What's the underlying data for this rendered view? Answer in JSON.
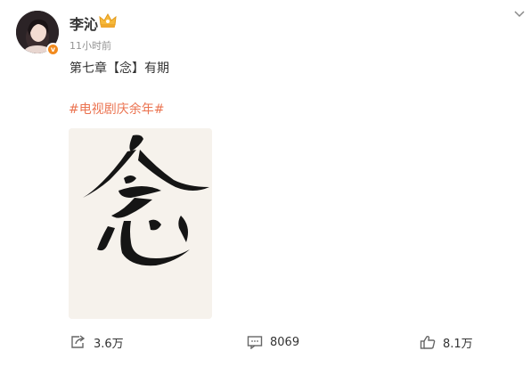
{
  "post": {
    "author": "李沁",
    "timestamp": "11小时前",
    "text": "第七章【念】有期",
    "hashtag": "#电视剧庆余年#",
    "image_char": "念"
  },
  "actions": {
    "repost": "3.6万",
    "comment": "8069",
    "like": "8.1万"
  },
  "icons": {
    "verified": "v-badge-icon",
    "member": "crown-icon",
    "menu": "chevron-down-icon",
    "repost": "repost-icon",
    "comment": "comment-icon",
    "like": "like-icon"
  },
  "colors": {
    "hashtag": "#eb7350",
    "badge": "#f28b1f",
    "text": "#333333",
    "meta": "#939393"
  }
}
